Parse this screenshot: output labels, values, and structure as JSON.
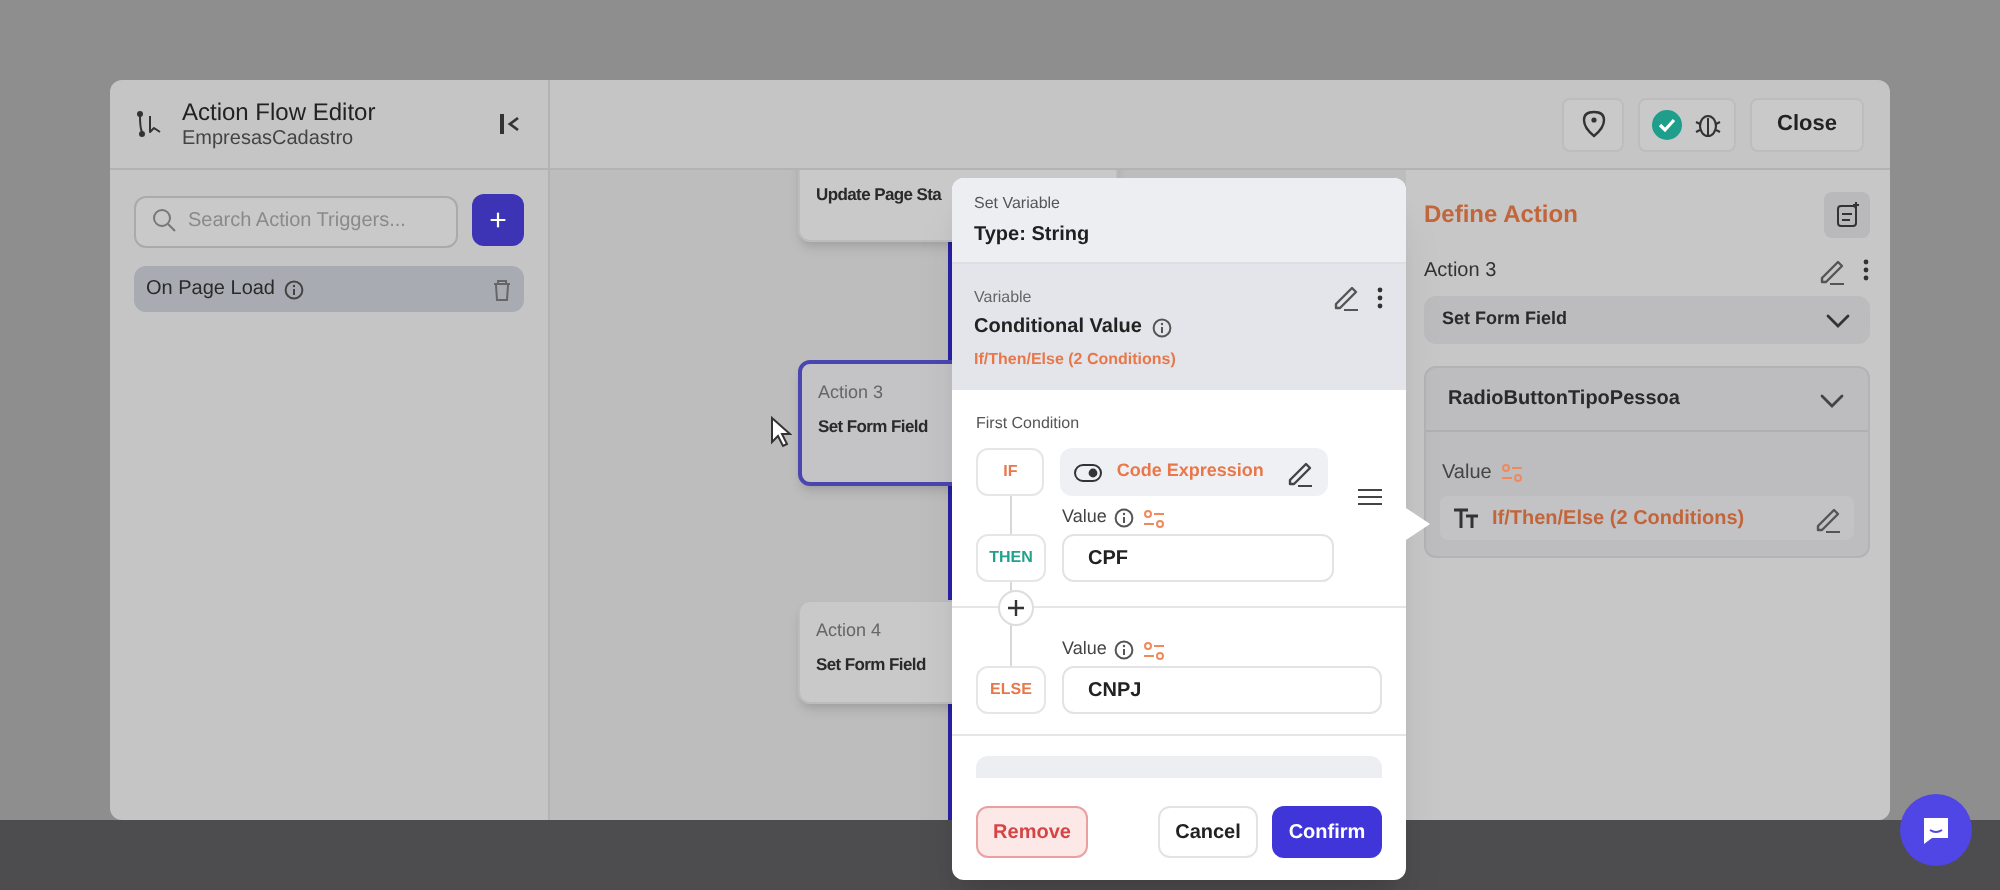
{
  "editor": {
    "title": "Action Flow Editor",
    "subtitle": "EmpresasCadastro",
    "close": "Close"
  },
  "triggers": {
    "search_placeholder": "Search Action Triggers...",
    "add": "+",
    "items": [
      {
        "label": "On Page Load",
        "selected": true
      }
    ]
  },
  "canvas": {
    "nodes": [
      {
        "title": "Update Page Sta",
        "selected": false
      },
      {
        "label": "Action 3",
        "title": "Set Form Field",
        "selected": true
      },
      {
        "label": "Action 4",
        "title": "Set Form Field",
        "selected": false
      }
    ]
  },
  "define_action": {
    "title": "Define Action",
    "action_label": "Action 3",
    "action_type": "Set Form Field",
    "field": "RadioButtonTipoPessoa",
    "value_label": "Value",
    "value": "If/Then/Else (2 Conditions)"
  },
  "popup": {
    "kind_label": "Set Variable",
    "type": "Type: String",
    "variable_label": "Variable",
    "variable_name": "Conditional Value",
    "variable_value": "If/Then/Else (2 Conditions)",
    "condition_title": "First Condition",
    "rows": [
      {
        "kind": "if",
        "badge": "IF",
        "value": "Code Expression"
      },
      {
        "kind": "then",
        "badge": "THEN",
        "value_label": "Value",
        "value": "CPF"
      },
      {
        "kind": "else",
        "badge": "ELSE",
        "value_label": "Value",
        "value": "CNPJ"
      }
    ],
    "buttons": [
      {
        "kind": "danger",
        "label": "Remove"
      },
      {
        "kind": "plain",
        "label": "Cancel"
      },
      {
        "kind": "primary",
        "label": "Confirm"
      }
    ]
  }
}
